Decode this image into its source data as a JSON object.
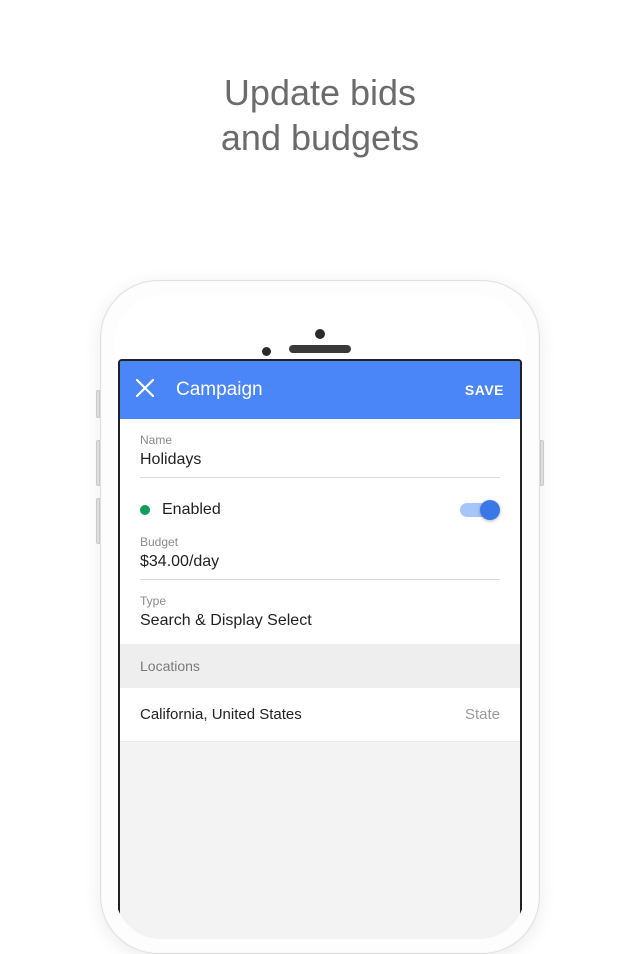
{
  "headline": {
    "line1": "Update bids",
    "line2": "and budgets"
  },
  "appbar": {
    "title": "Campaign",
    "save": "SAVE"
  },
  "fields": {
    "name_label": "Name",
    "name_value": "Holidays",
    "status_text": "Enabled",
    "budget_label": "Budget",
    "budget_value": "$34.00/day",
    "type_label": "Type",
    "type_value": "Search & Display Select"
  },
  "locations": {
    "header": "Locations",
    "items": [
      {
        "name": "California, United States",
        "type": "State"
      }
    ]
  }
}
